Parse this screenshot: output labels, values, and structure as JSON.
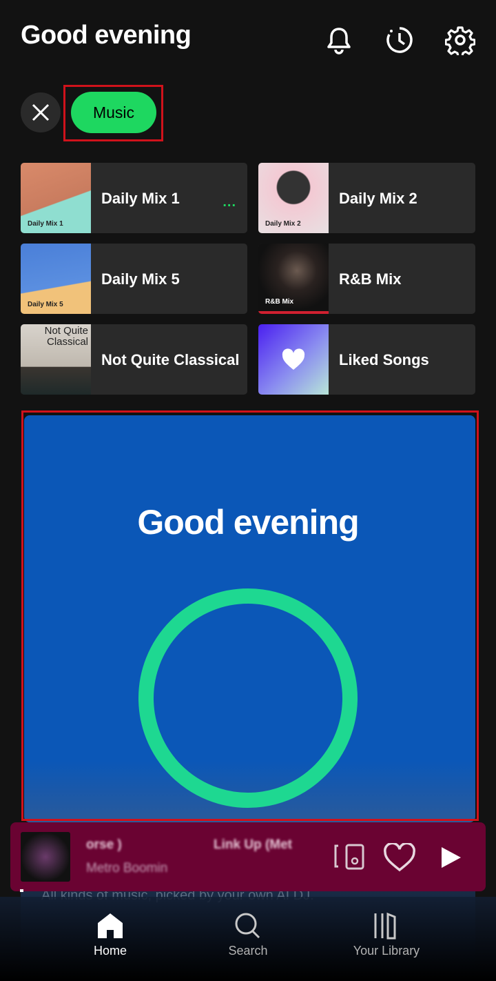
{
  "header": {
    "title": "Good evening",
    "icons": [
      "bell-icon",
      "history-icon",
      "gear-icon"
    ]
  },
  "filters": {
    "clear_icon": "close-icon",
    "chips": [
      {
        "label": "Music",
        "active": true
      }
    ]
  },
  "shortcuts": [
    {
      "label": "Daily Mix 1",
      "art_label": "Daily Mix 1",
      "more": "..."
    },
    {
      "label": "Daily Mix 2",
      "art_label": "Daily Mix 2"
    },
    {
      "label": "Daily Mix 5",
      "art_label": "Daily Mix 5"
    },
    {
      "label": "R&B Mix",
      "art_label": "R&B Mix"
    },
    {
      "label": "Not Quite Classical",
      "art_label": "Not Quite Classical"
    },
    {
      "label": "Liked Songs"
    }
  ],
  "dj_card": {
    "title": "Good evening",
    "subtitle": "All kinds of music, picked by your own AI DJ."
  },
  "mini_player": {
    "track": "orse )",
    "next_track": "Link Up (Met",
    "artist": "Metro Boomin",
    "icons": [
      "connect-device-icon",
      "heart-icon",
      "play-icon"
    ]
  },
  "nav": [
    {
      "label": "Home",
      "active": true
    },
    {
      "label": "Search"
    },
    {
      "label": "Your Library"
    }
  ],
  "colors": {
    "accent": "#1ed760",
    "dj_bg": "#0b57b7",
    "mini_bg": "#6a0332"
  }
}
